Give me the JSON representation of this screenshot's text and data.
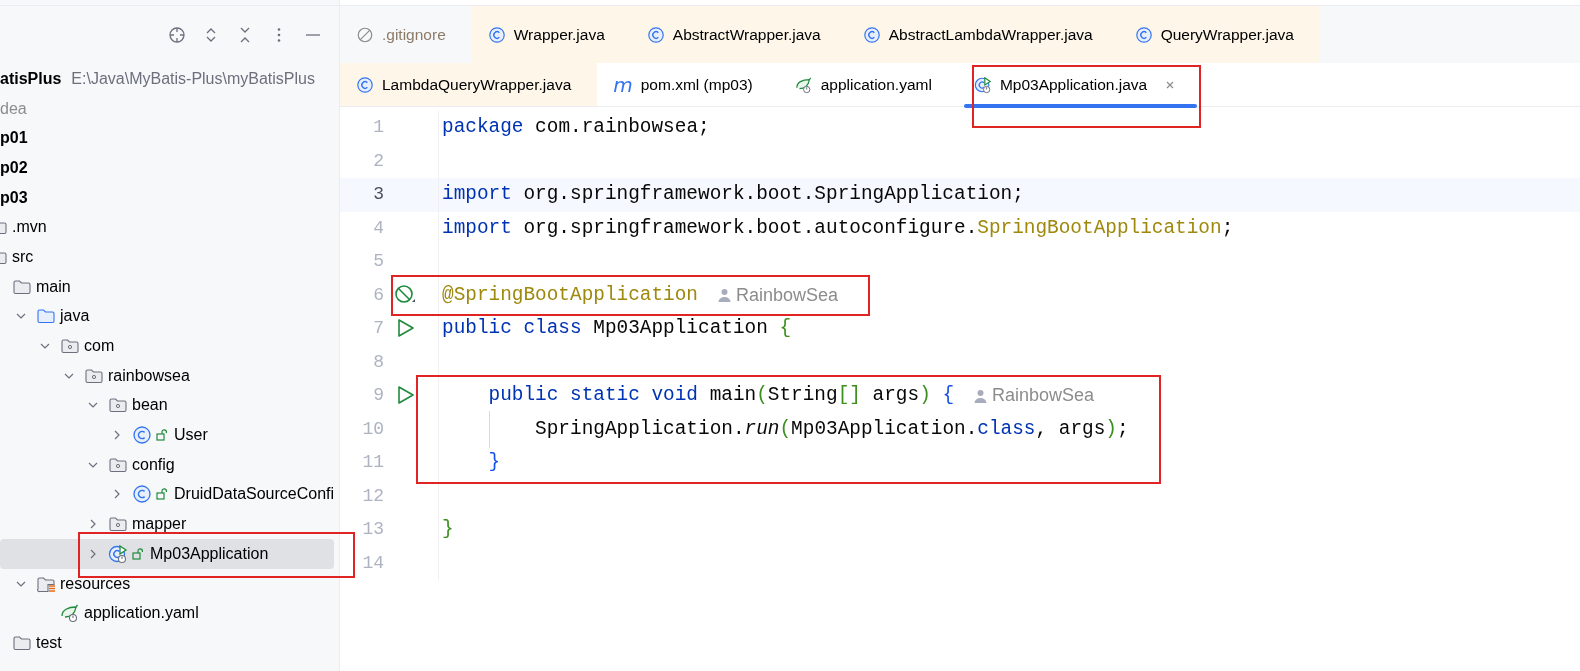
{
  "project_tree": [
    {
      "label": "atisPlus",
      "kind": "project",
      "path": "E:\\Java\\MyBatis-Plus\\myBatisPlus",
      "selected": false,
      "children": [
        {
          "label": "dea",
          "kind": "excluded",
          "selected": false
        },
        {
          "label": "p01",
          "kind": "module",
          "selected": false
        },
        {
          "label": "p02",
          "kind": "module",
          "selected": false
        },
        {
          "label": "p03",
          "kind": "module",
          "selected": false,
          "children": [
            {
              "label": ".mvn",
              "kind": "folder",
              "selected": false
            },
            {
              "label": "src",
              "kind": "folder",
              "selected": false,
              "children": [
                {
                  "label": "main",
                  "kind": "folder",
                  "selected": false,
                  "children": [
                    {
                      "label": "java",
                      "kind": "source_root",
                      "selected": false,
                      "expanded": true,
                      "children": [
                        {
                          "label": "com",
                          "kind": "package",
                          "selected": false,
                          "expanded": true,
                          "children": [
                            {
                              "label": "rainbowsea",
                              "kind": "package",
                              "selected": false,
                              "expanded": true,
                              "children": [
                                {
                                  "label": "bean",
                                  "kind": "package",
                                  "selected": false,
                                  "expanded": true,
                                  "children": [
                                    {
                                      "label": "User",
                                      "kind": "class",
                                      "selected": false,
                                      "expanded": false
                                    }
                                  ]
                                },
                                {
                                  "label": "config",
                                  "kind": "package",
                                  "selected": false,
                                  "expanded": true,
                                  "children": [
                                    {
                                      "label": "DruidDataSourceConfi",
                                      "kind": "class",
                                      "selected": false,
                                      "expanded": false
                                    }
                                  ]
                                },
                                {
                                  "label": "mapper",
                                  "kind": "package",
                                  "selected": false,
                                  "expanded": false
                                },
                                {
                                  "label": "Mp03Application",
                                  "kind": "app_class",
                                  "selected": true,
                                  "expanded": false,
                                  "annotated": true
                                }
                              ]
                            }
                          ]
                        }
                      ]
                    },
                    {
                      "label": "resources",
                      "kind": "resources_root",
                      "selected": false,
                      "expanded": true,
                      "children": [
                        {
                          "label": "application.yaml",
                          "kind": "yaml",
                          "selected": false
                        }
                      ]
                    }
                  ]
                },
                {
                  "label": "test",
                  "kind": "folder",
                  "selected": false
                }
              ]
            }
          ]
        }
      ]
    }
  ],
  "tab_rows": [
    {
      "tabs": [
        {
          "label": ".gitignore",
          "kind": "ignore",
          "library": false,
          "selected": false
        },
        {
          "label": "Wrapper.java",
          "kind": "class",
          "library": true,
          "selected": false
        },
        {
          "label": "AbstractWrapper.java",
          "kind": "class",
          "library": true,
          "selected": false
        },
        {
          "label": "AbstractLambdaWrapper.java",
          "kind": "class",
          "library": true,
          "selected": false
        },
        {
          "label": "QueryWrapper.java",
          "kind": "class",
          "library": true,
          "selected": false
        }
      ]
    },
    {
      "tabs": [
        {
          "label": "LambdaQueryWrapper.java",
          "kind": "class",
          "library": true,
          "selected": false
        },
        {
          "label": "pom.xml (mp03)",
          "kind": "maven",
          "icon_text": "m",
          "library": false,
          "selected": false
        },
        {
          "label": "application.yaml",
          "kind": "yaml",
          "library": false,
          "selected": false
        },
        {
          "label": "Mp03Application.java",
          "kind": "app_class",
          "library": false,
          "selected": true,
          "annotated": true
        }
      ]
    }
  ],
  "code_lines": [
    {
      "number": "1",
      "tokens": [
        {
          "text": "package",
          "kind": "keyword"
        },
        {
          "text": " com.rainbowsea;",
          "kind": "plain"
        }
      ]
    },
    {
      "number": "2"
    },
    {
      "number": "3",
      "current": true,
      "tokens": [
        {
          "text": "import",
          "kind": "keyword"
        },
        {
          "text": " org.springframework.boot.SpringApplication;",
          "kind": "plain"
        }
      ]
    },
    {
      "number": "4",
      "tokens": [
        {
          "text": "import",
          "kind": "keyword"
        },
        {
          "text": " org.springframework.boot.autoconfigure.",
          "kind": "plain"
        },
        {
          "text": "SpringBootApplication",
          "kind": "annotation"
        },
        {
          "text": ";",
          "kind": "plain"
        }
      ]
    },
    {
      "number": "5"
    },
    {
      "number": "6",
      "gutter": {
        "kind": "blocked"
      },
      "annotated": true,
      "hint": "RainbowSea",
      "tokens": [
        {
          "text": "@SpringBootApplication",
          "kind": "annotation"
        }
      ]
    },
    {
      "number": "7",
      "gutter": {
        "kind": "run"
      },
      "tokens": [
        {
          "text": "public class",
          "kind": "keyword"
        },
        {
          "text": " Mp03Application ",
          "kind": "plain"
        },
        {
          "text": "{",
          "kind": "bracket_green"
        }
      ]
    },
    {
      "number": "8"
    },
    {
      "number": "9",
      "gutter": {
        "kind": "run"
      },
      "annotated": true,
      "hint": "RainbowSea",
      "tokens": [
        {
          "text": "    public static void",
          "kind": "keyword"
        },
        {
          "text": " main",
          "kind": "plain"
        },
        {
          "text": "(",
          "kind": "bracket_green"
        },
        {
          "text": "String",
          "kind": "plain"
        },
        {
          "text": "[]",
          "kind": "bracket_green"
        },
        {
          "text": " args",
          "kind": "plain"
        },
        {
          "text": ") ",
          "kind": "bracket_green"
        },
        {
          "text": "{",
          "kind": "bracket_blue"
        }
      ]
    },
    {
      "number": "10",
      "annotated": true,
      "tokens": [
        {
          "text": "        SpringApplication.",
          "kind": "plain"
        },
        {
          "text": "run",
          "kind": "static_call"
        },
        {
          "text": "(",
          "kind": "bracket_green"
        },
        {
          "text": "Mp03Application.",
          "kind": "plain"
        },
        {
          "text": "class",
          "kind": "keyword"
        },
        {
          "text": ", args",
          "kind": "plain"
        },
        {
          "text": ")",
          "kind": "bracket_green"
        },
        {
          "text": ";",
          "kind": "plain"
        }
      ]
    },
    {
      "number": "11",
      "annotated": true,
      "tokens": [
        {
          "text": "    }",
          "kind": "bracket_blue"
        }
      ]
    },
    {
      "number": "12"
    },
    {
      "number": "13",
      "tokens": [
        {
          "text": "}",
          "kind": "bracket_green"
        }
      ]
    },
    {
      "number": "14"
    }
  ]
}
